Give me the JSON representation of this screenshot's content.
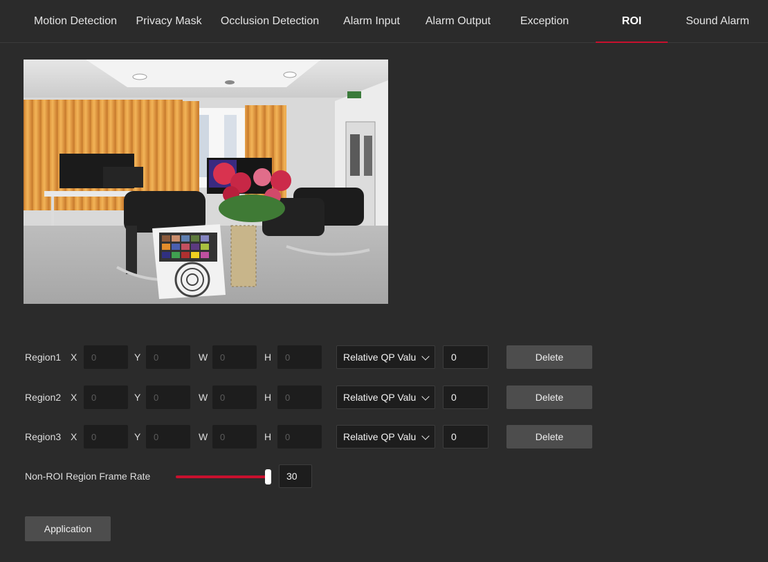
{
  "tabs": [
    {
      "label": "Motion Detection"
    },
    {
      "label": "Privacy Mask"
    },
    {
      "label": "Occlusion Detection"
    },
    {
      "label": "Alarm Input"
    },
    {
      "label": "Alarm Output"
    },
    {
      "label": "Exception"
    },
    {
      "label": "ROI",
      "active": true
    },
    {
      "label": "Sound Alarm"
    }
  ],
  "regions": [
    {
      "label": "Region1",
      "x_label": "X",
      "y_label": "Y",
      "w_label": "W",
      "h_label": "H",
      "x": "0",
      "y": "0",
      "w": "0",
      "h": "0",
      "qp_type": "Relative QP Valu",
      "qp_value": "0",
      "delete_label": "Delete"
    },
    {
      "label": "Region2",
      "x_label": "X",
      "y_label": "Y",
      "w_label": "W",
      "h_label": "H",
      "x": "0",
      "y": "0",
      "w": "0",
      "h": "0",
      "qp_type": "Relative QP Valu",
      "qp_value": "0",
      "delete_label": "Delete"
    },
    {
      "label": "Region3",
      "x_label": "X",
      "y_label": "Y",
      "w_label": "W",
      "h_label": "H",
      "x": "0",
      "y": "0",
      "w": "0",
      "h": "0",
      "qp_type": "Relative QP Valu",
      "qp_value": "0",
      "delete_label": "Delete"
    }
  ],
  "frame_rate": {
    "label": "Non-ROI Region Frame Rate",
    "value": "30",
    "slider_fraction": 1.0
  },
  "apply_label": "Application",
  "colors": {
    "accent": "#c8102e",
    "background": "#2b2b2b",
    "input_bg": "#1d1d1d",
    "button_bg": "#4d4d4d"
  },
  "icons": {
    "select_caret": "chevron-down-icon"
  }
}
